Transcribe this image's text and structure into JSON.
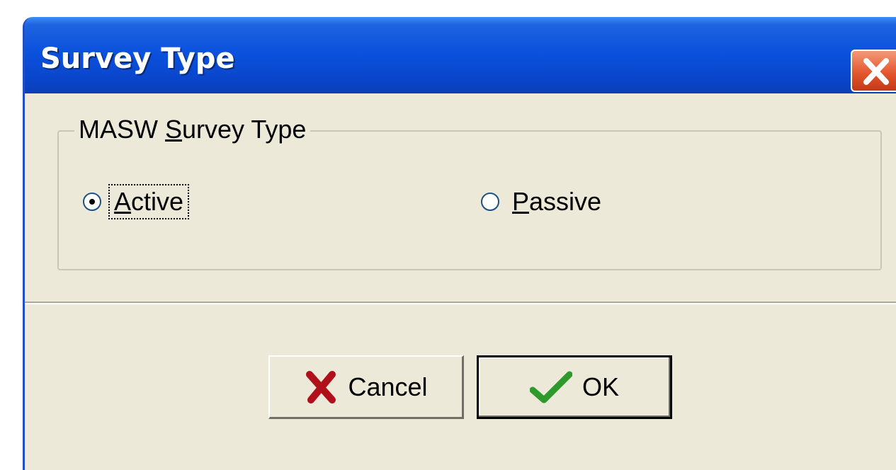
{
  "window": {
    "title": "Survey Type",
    "close_icon": "close-icon"
  },
  "group": {
    "legend_prefix": "MASW ",
    "legend_accel": "S",
    "legend_suffix": "urvey Type"
  },
  "options": [
    {
      "accel": "A",
      "rest": "ctive",
      "checked": true
    },
    {
      "accel": "P",
      "rest": "assive",
      "checked": false
    }
  ],
  "buttons": {
    "cancel_label": "Cancel",
    "cancel_icon": "red-x-icon",
    "ok_label": "OK",
    "ok_icon": "green-check-icon"
  },
  "colors": {
    "titlebar": "#0b52dd",
    "dialog_bg": "#ece9d8",
    "close_button": "#e4572e"
  }
}
